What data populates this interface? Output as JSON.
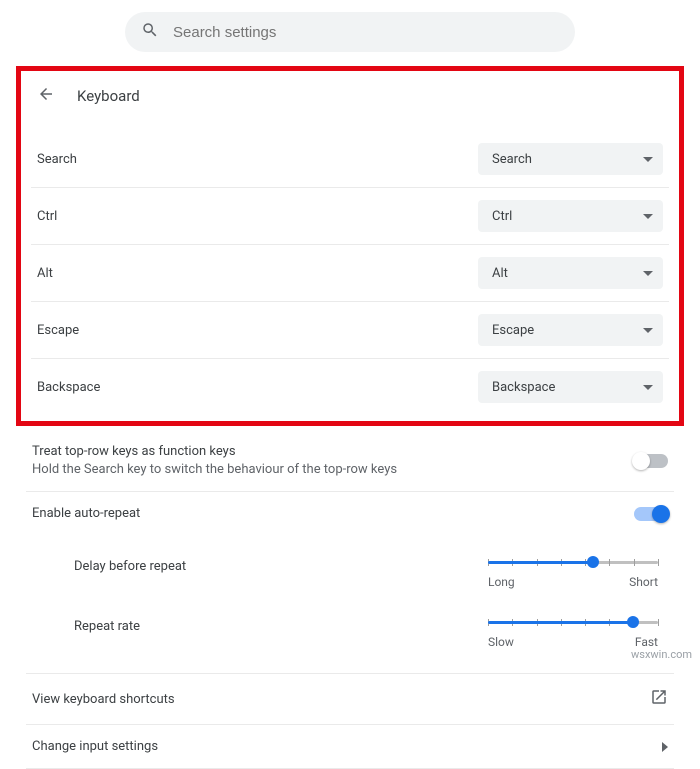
{
  "search": {
    "placeholder": "Search settings"
  },
  "header": {
    "title": "Keyboard"
  },
  "keys": [
    {
      "label": "Search",
      "value": "Search"
    },
    {
      "label": "Ctrl",
      "value": "Ctrl"
    },
    {
      "label": "Alt",
      "value": "Alt"
    },
    {
      "label": "Escape",
      "value": "Escape"
    },
    {
      "label": "Backspace",
      "value": "Backspace"
    }
  ],
  "toprow": {
    "title": "Treat top-row keys as function keys",
    "subtitle": "Hold the Search key to switch the behaviour of the top-row keys",
    "enabled": false
  },
  "autorepeat": {
    "title": "Enable auto-repeat",
    "enabled": true,
    "delay": {
      "label": "Delay before repeat",
      "left": "Long",
      "right": "Short",
      "value_pct": 62
    },
    "rate": {
      "label": "Repeat rate",
      "left": "Slow",
      "right": "Fast",
      "value_pct": 85
    }
  },
  "shortcuts": {
    "label": "View keyboard shortcuts"
  },
  "input": {
    "label": "Change input settings"
  },
  "watermark": "wsxwin.com"
}
